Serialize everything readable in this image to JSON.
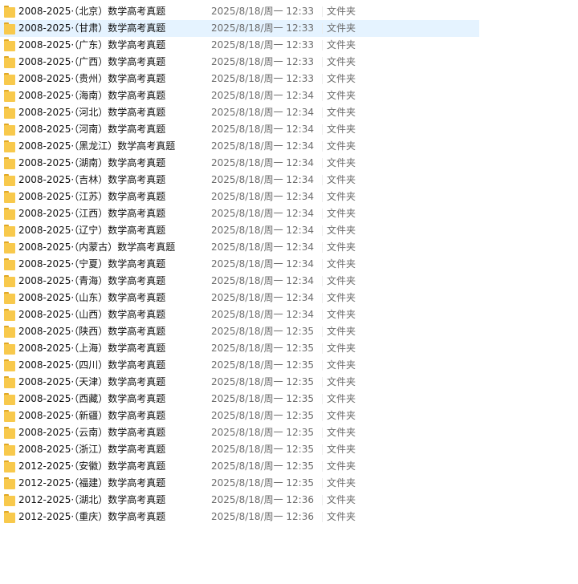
{
  "files": [
    {
      "name": "2008-2025·（北京）数学高考真题",
      "modified": "2025/8/18/周一 12:33",
      "type": "文件夹"
    },
    {
      "name": "2008-2025·（甘肃）数学高考真题",
      "modified": "2025/8/18/周一 12:33",
      "type": "文件夹",
      "selected": true
    },
    {
      "name": "2008-2025·（广东）数学高考真题",
      "modified": "2025/8/18/周一 12:33",
      "type": "文件夹"
    },
    {
      "name": "2008-2025·（广西）数学高考真题",
      "modified": "2025/8/18/周一 12:33",
      "type": "文件夹"
    },
    {
      "name": "2008-2025·（贵州）数学高考真题",
      "modified": "2025/8/18/周一 12:33",
      "type": "文件夹"
    },
    {
      "name": "2008-2025·（海南）数学高考真题",
      "modified": "2025/8/18/周一 12:34",
      "type": "文件夹"
    },
    {
      "name": "2008-2025·（河北）数学高考真题",
      "modified": "2025/8/18/周一 12:34",
      "type": "文件夹"
    },
    {
      "name": "2008-2025·（河南）数学高考真题",
      "modified": "2025/8/18/周一 12:34",
      "type": "文件夹"
    },
    {
      "name": "2008-2025·（黑龙江）数学高考真题",
      "modified": "2025/8/18/周一 12:34",
      "type": "文件夹"
    },
    {
      "name": "2008-2025·（湖南）数学高考真题",
      "modified": "2025/8/18/周一 12:34",
      "type": "文件夹"
    },
    {
      "name": "2008-2025·（吉林）数学高考真题",
      "modified": "2025/8/18/周一 12:34",
      "type": "文件夹"
    },
    {
      "name": "2008-2025·（江苏）数学高考真题",
      "modified": "2025/8/18/周一 12:34",
      "type": "文件夹"
    },
    {
      "name": "2008-2025·（江西）数学高考真题",
      "modified": "2025/8/18/周一 12:34",
      "type": "文件夹"
    },
    {
      "name": "2008-2025·（辽宁）数学高考真题",
      "modified": "2025/8/18/周一 12:34",
      "type": "文件夹"
    },
    {
      "name": "2008-2025·（内蒙古）数学高考真题",
      "modified": "2025/8/18/周一 12:34",
      "type": "文件夹"
    },
    {
      "name": "2008-2025·（宁夏）数学高考真题",
      "modified": "2025/8/18/周一 12:34",
      "type": "文件夹"
    },
    {
      "name": "2008-2025·（青海）数学高考真题",
      "modified": "2025/8/18/周一 12:34",
      "type": "文件夹"
    },
    {
      "name": "2008-2025·（山东）数学高考真题",
      "modified": "2025/8/18/周一 12:34",
      "type": "文件夹"
    },
    {
      "name": "2008-2025·（山西）数学高考真题",
      "modified": "2025/8/18/周一 12:34",
      "type": "文件夹"
    },
    {
      "name": "2008-2025·（陕西）数学高考真题",
      "modified": "2025/8/18/周一 12:35",
      "type": "文件夹"
    },
    {
      "name": "2008-2025·（上海）数学高考真题",
      "modified": "2025/8/18/周一 12:35",
      "type": "文件夹"
    },
    {
      "name": "2008-2025·（四川）数学高考真题",
      "modified": "2025/8/18/周一 12:35",
      "type": "文件夹"
    },
    {
      "name": "2008-2025·（天津）数学高考真题",
      "modified": "2025/8/18/周一 12:35",
      "type": "文件夹"
    },
    {
      "name": "2008-2025·（西藏）数学高考真题",
      "modified": "2025/8/18/周一 12:35",
      "type": "文件夹"
    },
    {
      "name": "2008-2025·（新疆）数学高考真题",
      "modified": "2025/8/18/周一 12:35",
      "type": "文件夹"
    },
    {
      "name": "2008-2025·（云南）数学高考真题",
      "modified": "2025/8/18/周一 12:35",
      "type": "文件夹"
    },
    {
      "name": "2008-2025·（浙江）数学高考真题",
      "modified": "2025/8/18/周一 12:35",
      "type": "文件夹"
    },
    {
      "name": "2012-2025·（安徽）数学高考真题",
      "modified": "2025/8/18/周一 12:35",
      "type": "文件夹"
    },
    {
      "name": "2012-2025·（福建）数学高考真题",
      "modified": "2025/8/18/周一 12:35",
      "type": "文件夹"
    },
    {
      "name": "2012-2025·（湖北）数学高考真题",
      "modified": "2025/8/18/周一 12:36",
      "type": "文件夹"
    },
    {
      "name": "2012-2025·（重庆）数学高考真题",
      "modified": "2025/8/18/周一 12:36",
      "type": "文件夹"
    }
  ],
  "colors": {
    "selected_row": "#e5f3ff",
    "folder_icon": "#f8c94c",
    "name_text": "#111111",
    "meta_text": "#6d6d6d"
  },
  "icons": {
    "row_icon": "folder-icon"
  }
}
